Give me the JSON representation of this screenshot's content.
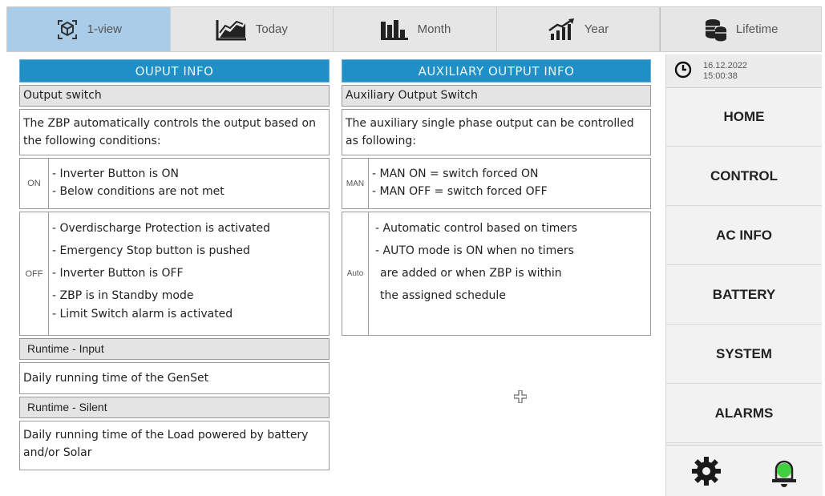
{
  "tabs": [
    {
      "label": "1-view",
      "icon": "cube-icon",
      "active": true
    },
    {
      "label": "Today",
      "icon": "area-chart-icon",
      "active": false
    },
    {
      "label": "Month",
      "icon": "bar-chart-icon",
      "active": false
    },
    {
      "label": "Year",
      "icon": "trend-up-icon",
      "active": false
    },
    {
      "label": "Lifetime",
      "icon": "coins-stack-icon",
      "active": false
    }
  ],
  "output": {
    "header": "OUPUT INFO",
    "switch_title": "Output switch",
    "switch_desc": "The ZBP automatically controls the output based on the following conditions:",
    "on_key": "ON",
    "on_lines": [
      "- Inverter Button is ON",
      "- Below conditions are not met"
    ],
    "off_key": "OFF",
    "off_lines": [
      "- Overdischarge Protection is activated",
      "- Emergency Stop button is pushed",
      "- Inverter Button is OFF",
      "- ZBP is in Standby mode",
      "- Limit Switch alarm is activated"
    ],
    "runtime_input_title": "Runtime - Input",
    "runtime_input_desc": "Daily running time of the GenSet",
    "runtime_silent_title": "Runtime - Silent",
    "runtime_silent_desc": "Daily running time of the Load powered by battery and/or Solar"
  },
  "aux": {
    "header": "AUXILIARY OUTPUT INFO",
    "switch_title": "Auxiliary Output Switch",
    "switch_desc": "The auxiliary single phase output can be controlled as following:",
    "man_key": "MAN",
    "man_lines": [
      "- MAN ON = switch forced ON",
      "- MAN OFF = switch forced OFF"
    ],
    "auto_key": "Auto",
    "auto_lines": [
      "- Automatic control based on timers",
      "- AUTO mode is ON when no timers",
      "are added or when ZBP is within",
      "the assigned schedule"
    ]
  },
  "clock": {
    "date": "16.12.2022",
    "time": "15:00:38",
    "icon": "clock-icon"
  },
  "nav": [
    "HOME",
    "CONTROL",
    "AC INFO",
    "BATTERY",
    "SYSTEM",
    "ALARMS"
  ],
  "colors": {
    "accent": "#1f8fc6",
    "active_tab": "#a9cde8",
    "alarm_bell_light": "#3fcf3f"
  },
  "bottom_icons": [
    "gear-icon",
    "alarm-bell-icon"
  ]
}
